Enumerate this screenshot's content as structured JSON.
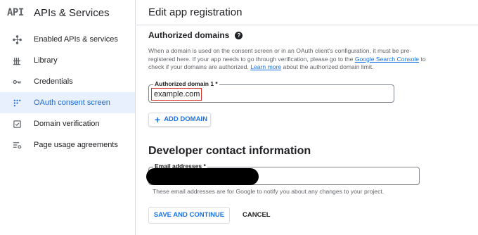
{
  "sidebar": {
    "logo": "API",
    "title": "APIs & Services",
    "items": [
      {
        "label": "Enabled APIs & services",
        "icon": "diamond-move-icon"
      },
      {
        "label": "Library",
        "icon": "library-icon"
      },
      {
        "label": "Credentials",
        "icon": "key-icon"
      },
      {
        "label": "OAuth consent screen",
        "icon": "dots-grid-icon",
        "active": true
      },
      {
        "label": "Domain verification",
        "icon": "checkbox-icon"
      },
      {
        "label": "Page usage agreements",
        "icon": "list-settings-icon"
      }
    ]
  },
  "header": {
    "title": "Edit app registration"
  },
  "authorized_domains": {
    "title": "Authorized domains",
    "help_icon": "?",
    "desc_part1": "When a domain is used on the consent screen or in an OAuth client's configuration, it must be pre-registered here. If your app needs to go through verification, please go to the ",
    "desc_link1": "Google Search Console",
    "desc_part2": " to check if your domains are authorized. ",
    "desc_link2": "Learn more",
    "desc_part3": " about the authorized domain limit.",
    "field_label": "Authorized domain 1 *",
    "field_value": "example.com",
    "add_button": "ADD DOMAIN"
  },
  "developer_contact": {
    "title": "Developer contact information",
    "field_label": "Email addresses *",
    "hint": "These email addresses are for Google to notify you about any changes to your project."
  },
  "actions": {
    "save": "SAVE AND CONTINUE",
    "cancel": "CANCEL"
  },
  "colors": {
    "accent": "#1a73e8",
    "active_bg": "#e8f0fe",
    "highlight_border": "#d93025"
  }
}
